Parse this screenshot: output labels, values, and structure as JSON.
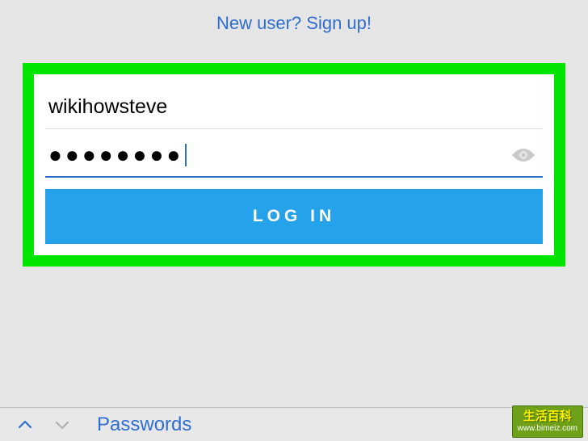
{
  "signup": {
    "text": "New user? Sign up!"
  },
  "form": {
    "username_value": "wikihowsteve",
    "password_masked": "●●●●●●●●",
    "login_label": "LOG IN"
  },
  "keyboard_bar": {
    "passwords_label": "Passwords"
  },
  "watermark": {
    "title": "生活百科",
    "url": "www.bimeiz.com"
  },
  "colors": {
    "highlight_green": "#00e400",
    "link_blue": "#2f6ecf",
    "button_blue": "#26a2ea"
  }
}
